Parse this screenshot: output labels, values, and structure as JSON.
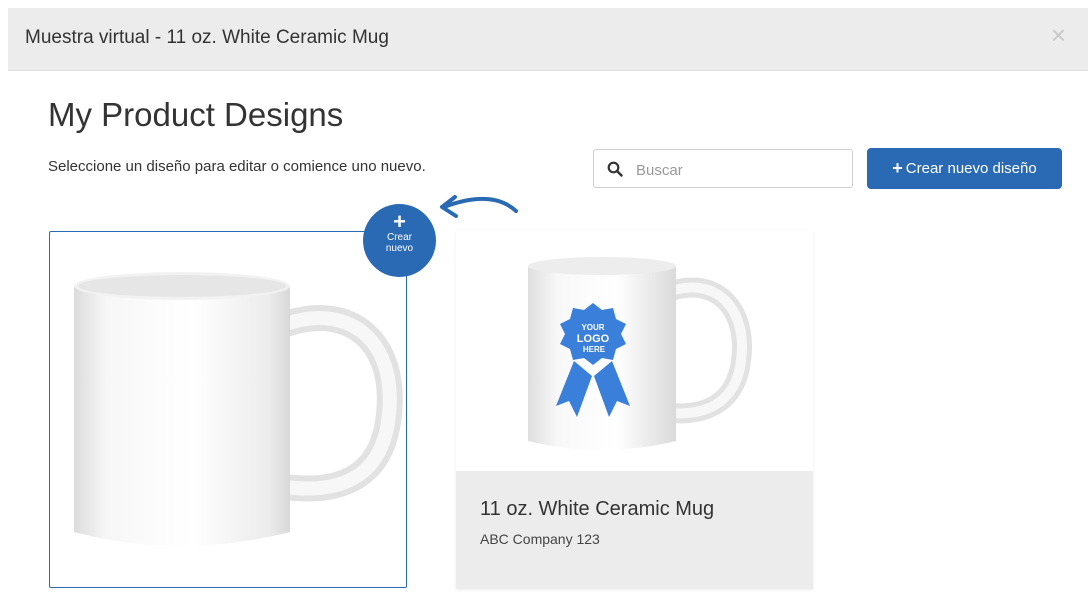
{
  "modal": {
    "title": "Muestra virtual - 11 oz. White Ceramic Mug",
    "close": "×"
  },
  "page": {
    "title": "My Product Designs",
    "subtitle": "Seleccione un diseño para editar o comience uno nuevo."
  },
  "search": {
    "placeholder": "Buscar",
    "value": ""
  },
  "new_design_button": {
    "icon": "+",
    "label": "Crear nuevo diseño"
  },
  "create_badge": {
    "icon": "+",
    "line1": "Crear",
    "line2": "nuevo"
  },
  "logo_badge": {
    "line1": "YOUR",
    "line2": "LOGO",
    "line3": "HERE"
  },
  "designs": [
    {
      "name": "11 oz. White Ceramic Mug",
      "company": "ABC Company 123"
    }
  ],
  "colors": {
    "accent": "#2a6ab5",
    "header_bg": "#ececec",
    "logo_blue": "#3a7fd9"
  }
}
